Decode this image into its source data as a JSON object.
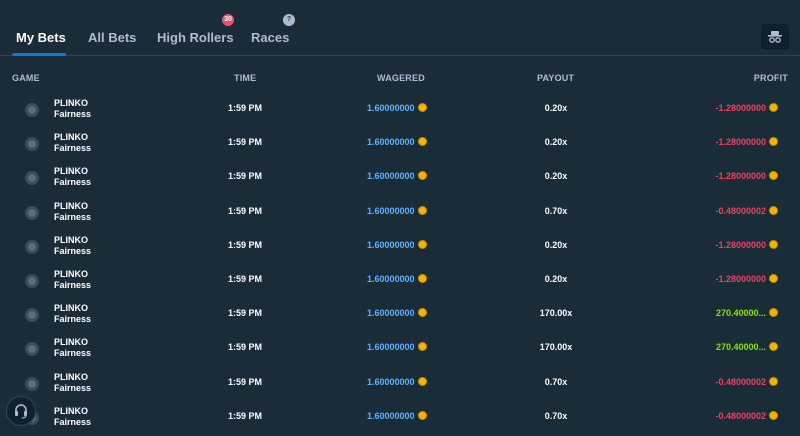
{
  "tabs": [
    {
      "label": "My Bets",
      "active": true
    },
    {
      "label": "All Bets"
    },
    {
      "label": "High Rollers",
      "badge": "30"
    },
    {
      "label": "Races",
      "badge": "?"
    }
  ],
  "columns": {
    "game": "GAME",
    "time": "TIME",
    "wagered": "WAGERED",
    "payout": "PAYOUT",
    "profit": "PROFIT"
  },
  "icons": {
    "hide_button": "incognito-icon",
    "currency": "coin-icon",
    "game": "plinko-icon",
    "support": "headset-icon"
  },
  "colors": {
    "background": "#1a2c38",
    "wagered": "#5fb1ff",
    "loss": "#ed4163",
    "win": "#84e400"
  },
  "rows": [
    {
      "game": "PLINKO",
      "sub": "Fairness",
      "time": "1:59 PM",
      "wagered": "1.60000000",
      "payout": "0.20x",
      "profit": "-1.28000000",
      "result": "loss"
    },
    {
      "game": "PLINKO",
      "sub": "Fairness",
      "time": "1:59 PM",
      "wagered": "1.60000000",
      "payout": "0.20x",
      "profit": "-1.28000000",
      "result": "loss"
    },
    {
      "game": "PLINKO",
      "sub": "Fairness",
      "time": "1:59 PM",
      "wagered": "1.60000000",
      "payout": "0.20x",
      "profit": "-1.28000000",
      "result": "loss"
    },
    {
      "game": "PLINKO",
      "sub": "Fairness",
      "time": "1:59 PM",
      "wagered": "1.60000000",
      "payout": "0.70x",
      "profit": "-0.48000002",
      "result": "loss"
    },
    {
      "game": "PLINKO",
      "sub": "Fairness",
      "time": "1:59 PM",
      "wagered": "1.60000000",
      "payout": "0.20x",
      "profit": "-1.28000000",
      "result": "loss"
    },
    {
      "game": "PLINKO",
      "sub": "Fairness",
      "time": "1:59 PM",
      "wagered": "1.60000000",
      "payout": "0.20x",
      "profit": "-1.28000000",
      "result": "loss"
    },
    {
      "game": "PLINKO",
      "sub": "Fairness",
      "time": "1:59 PM",
      "wagered": "1.60000000",
      "payout": "170.00x",
      "profit": "270.40000...",
      "result": "win"
    },
    {
      "game": "PLINKO",
      "sub": "Fairness",
      "time": "1:59 PM",
      "wagered": "1.60000000",
      "payout": "170.00x",
      "profit": "270.40000...",
      "result": "win"
    },
    {
      "game": "PLINKO",
      "sub": "Fairness",
      "time": "1:59 PM",
      "wagered": "1.60000000",
      "payout": "0.70x",
      "profit": "-0.48000002",
      "result": "loss"
    },
    {
      "game": "PLINKO",
      "sub": "Fairness",
      "time": "1:59 PM",
      "wagered": "1.60000000",
      "payout": "0.70x",
      "profit": "-0.48000002",
      "result": "loss"
    }
  ]
}
